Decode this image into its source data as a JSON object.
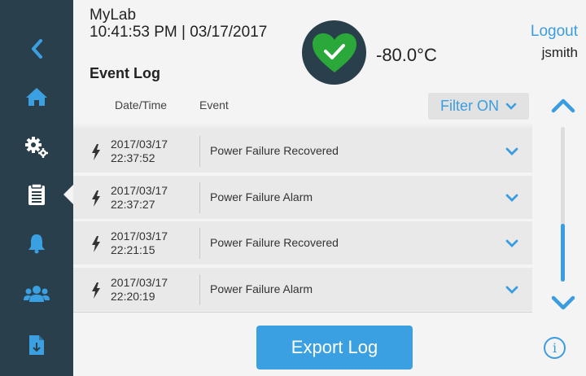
{
  "header": {
    "app_name": "MyLab",
    "datetime": "10:41:53 PM | 03/17/2017",
    "page_title": "Event Log",
    "temperature": "-80.0°C",
    "status_icon": "heart-check-icon",
    "logout_label": "Logout",
    "username": "jsmith"
  },
  "sidebar": {
    "items": [
      {
        "icon": "back-chevron-icon"
      },
      {
        "icon": "home-icon"
      },
      {
        "icon": "settings-gears-icon"
      },
      {
        "icon": "clipboard-log-icon",
        "active": true
      },
      {
        "icon": "bell-alarm-icon"
      },
      {
        "icon": "users-group-icon"
      },
      {
        "icon": "file-export-icon"
      }
    ]
  },
  "list": {
    "col_datetime": "Date/Time",
    "col_event": "Event",
    "filter_label": "Filter ON",
    "events": [
      {
        "date": "2017/03/17",
        "time": "22:37:52",
        "event": "Power Failure Recovered"
      },
      {
        "date": "2017/03/17",
        "time": "22:37:27",
        "event": "Power Failure Alarm"
      },
      {
        "date": "2017/03/17",
        "time": "22:21:15",
        "event": "Power Failure Recovered"
      },
      {
        "date": "2017/03/17",
        "time": "22:20:19",
        "event": "Power Failure Alarm"
      }
    ]
  },
  "footer": {
    "export_label": "Export Log",
    "info_glyph": "i"
  },
  "colors": {
    "sidebar": "#2a3f4c",
    "accent": "#3a9de0",
    "status_ok": "#2aa83a"
  }
}
